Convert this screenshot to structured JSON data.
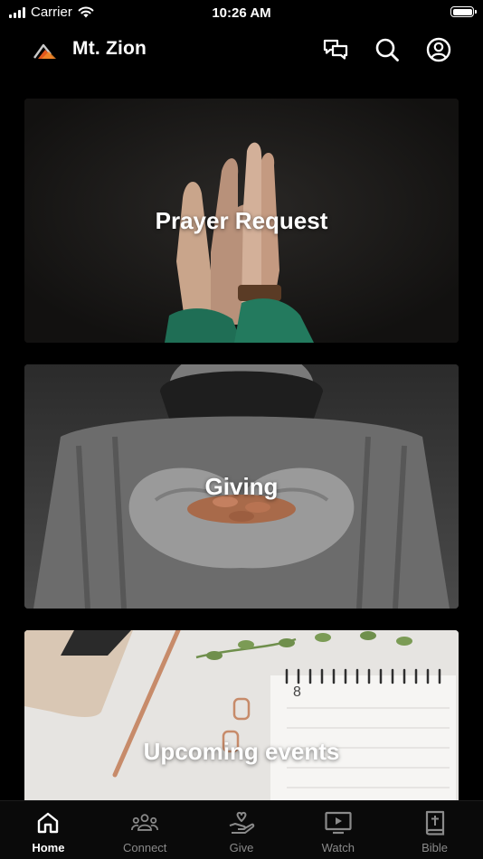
{
  "status_bar": {
    "carrier": "Carrier",
    "time": "10:26 AM"
  },
  "header": {
    "title": "Mt. Zion",
    "icons": [
      "chat-icon",
      "search-icon",
      "account-icon"
    ]
  },
  "cards": [
    {
      "label": "Prayer Request"
    },
    {
      "label": "Giving"
    },
    {
      "label": "Upcoming events"
    }
  ],
  "calendar": {
    "month_digit": "8"
  },
  "tab_bar": {
    "active": "Home",
    "tabs": [
      {
        "label": "Home",
        "icon": "home-icon"
      },
      {
        "label": "Connect",
        "icon": "people-icon"
      },
      {
        "label": "Give",
        "icon": "give-icon"
      },
      {
        "label": "Watch",
        "icon": "video-icon"
      },
      {
        "label": "Bible",
        "icon": "bible-icon"
      }
    ]
  },
  "colors": {
    "background": "#000000",
    "tab_inactive": "#8a8a8a",
    "logo_accent": "#e2571d"
  }
}
